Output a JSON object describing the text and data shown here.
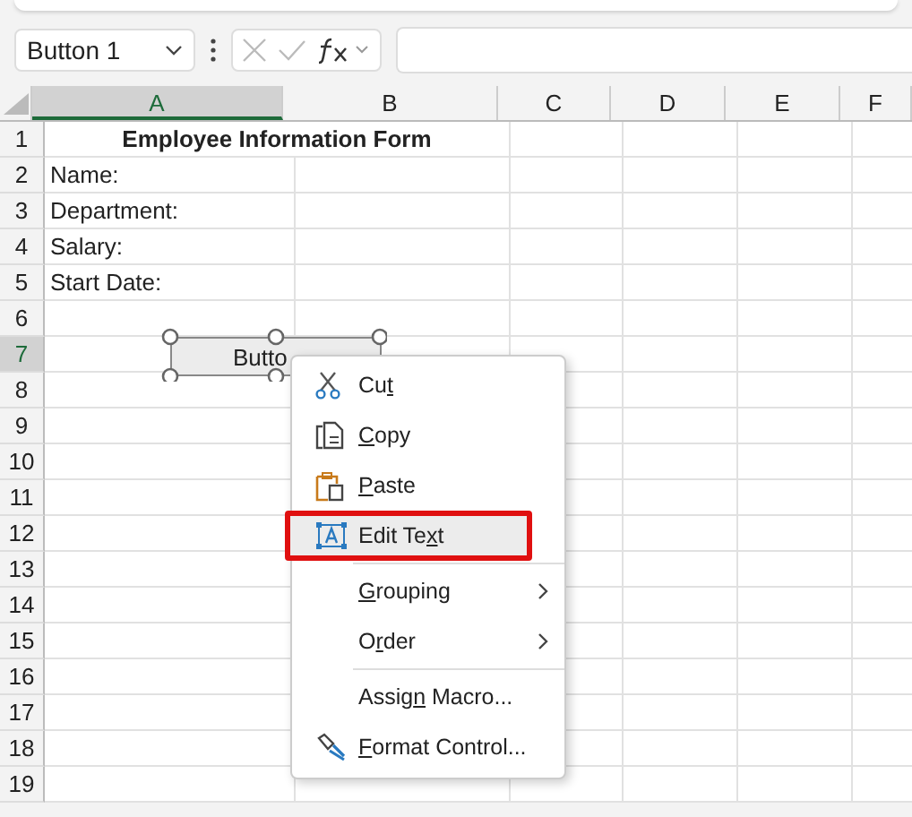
{
  "name_box": {
    "value": "Button 1"
  },
  "columns": [
    {
      "label": "A",
      "selected": true
    },
    {
      "label": "B",
      "selected": false
    },
    {
      "label": "C",
      "selected": false
    },
    {
      "label": "D",
      "selected": false
    },
    {
      "label": "E",
      "selected": false
    },
    {
      "label": "F",
      "selected": false
    }
  ],
  "rows": [
    {
      "header": "1",
      "selected": false,
      "kind": "title",
      "text": "Employee Information Form"
    },
    {
      "header": "2",
      "selected": false,
      "kind": "label",
      "text": "Name:"
    },
    {
      "header": "3",
      "selected": false,
      "kind": "label",
      "text": "Department:"
    },
    {
      "header": "4",
      "selected": false,
      "kind": "label",
      "text": "Salary:"
    },
    {
      "header": "5",
      "selected": false,
      "kind": "label",
      "text": "Start Date:"
    },
    {
      "header": "6",
      "selected": false
    },
    {
      "header": "7",
      "selected": true
    },
    {
      "header": "8",
      "selected": false
    },
    {
      "header": "9",
      "selected": false
    },
    {
      "header": "10",
      "selected": false
    },
    {
      "header": "11",
      "selected": false
    },
    {
      "header": "12",
      "selected": false
    },
    {
      "header": "13",
      "selected": false
    },
    {
      "header": "14",
      "selected": false
    },
    {
      "header": "15",
      "selected": false
    },
    {
      "header": "16",
      "selected": false
    },
    {
      "header": "17",
      "selected": false
    },
    {
      "header": "18",
      "selected": false
    },
    {
      "header": "19",
      "selected": false
    }
  ],
  "form_button": {
    "label": "Butto"
  },
  "context_menu": [
    {
      "kind": "item",
      "label": "Cut",
      "selected": false
    },
    {
      "kind": "item",
      "label": "Copy",
      "selected": false
    },
    {
      "kind": "item",
      "label": "Paste",
      "selected": false
    },
    {
      "kind": "item",
      "label": "Edit Text",
      "selected": true
    },
    {
      "kind": "separator"
    },
    {
      "kind": "submenu",
      "label": "Grouping",
      "selected": false
    },
    {
      "kind": "submenu",
      "label": "Order",
      "selected": false
    },
    {
      "kind": "separator"
    },
    {
      "kind": "item",
      "label": "Assign Macro...",
      "selected": false
    },
    {
      "kind": "item",
      "label": "Format Control...",
      "selected": false
    }
  ]
}
